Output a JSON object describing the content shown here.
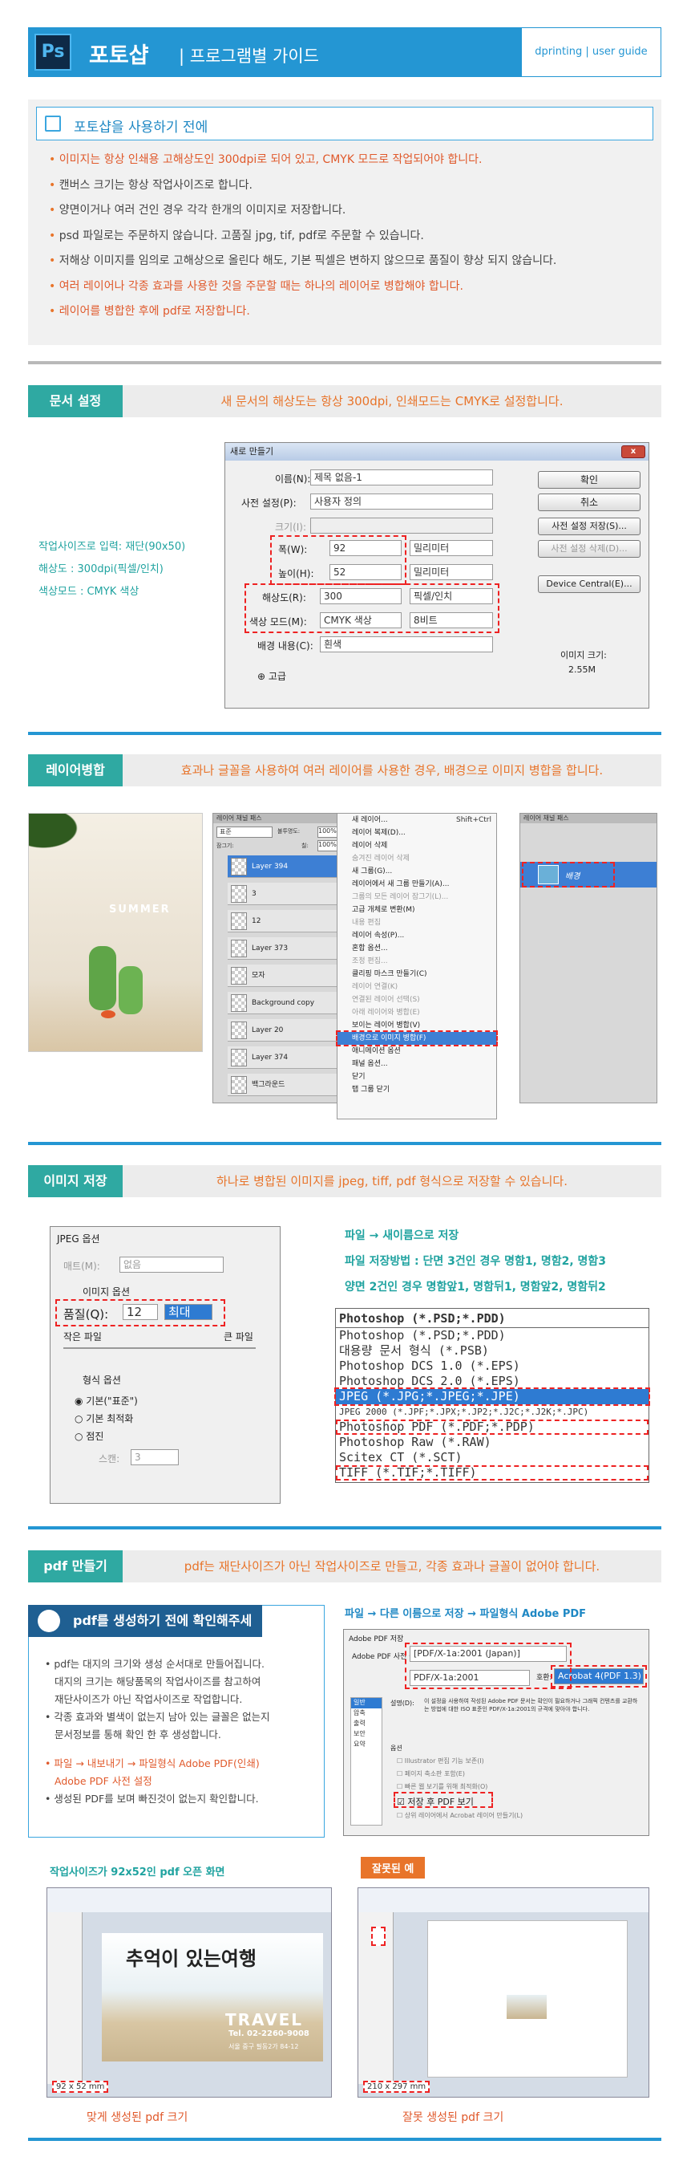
{
  "header": {
    "logo": "Ps",
    "title": "포토샵",
    "subtitle": "| 프로그램별 가이드",
    "right": "dprinting  |  user guide"
  },
  "intro": {
    "heading": "포토샵을 사용하기 전에",
    "items": [
      {
        "text": "이미지는 항상 인쇄용 고해상도인 300dpi로 되어 있고, CMYK 모드로 작업되어야 합니다.",
        "highlight": true
      },
      {
        "text": "캔버스 크기는 항상 작업사이즈로 합니다.",
        "highlight": false
      },
      {
        "text": "양면이거나 여러 건인 경우 각각 한개의 이미지로 저장합니다.",
        "highlight": false
      },
      {
        "text": "psd 파일로는 주문하지 않습니다. 고품질 jpg, tif, pdf로 주문할 수 있습니다.",
        "highlight": false
      },
      {
        "text": "저해상 이미지를 임의로 고해상으로 올린다 해도, 기본 픽셀은 변하지 않으므로 품질이 향상 되지 않습니다.",
        "highlight": false
      },
      {
        "text": "여러 레이어나 각종 효과를 사용한 것을 주문할 때는 하나의 레이어로 병합해야 합니다.",
        "highlight": true
      },
      {
        "text": "레이어를 병합한 후에 pdf로 저장합니다.",
        "highlight": true
      }
    ]
  },
  "doc": {
    "tag": "문서 설정",
    "desc": "새 문서의 해상도는 항상 300dpi, 인쇄모드는 CMYK로 설정합니다.",
    "notes": [
      "작업사이즈로 입력: 재단(90x50)",
      "해상도 : 300dpi(픽셀/인치)",
      "색상모드 : CMYK 색상"
    ],
    "dialog": {
      "title": "새로 만들기",
      "close": "x",
      "name_label": "이름(N):",
      "name_value": "제목 없음-1",
      "preset_label": "사전 설정(P):",
      "preset_value": "사용자 정의",
      "size_label": "크기(I):",
      "width_label": "폭(W):",
      "width_value": "92",
      "height_label": "높이(H):",
      "height_value": "52",
      "unit": "밀리미터",
      "res_label": "해상도(R):",
      "res_value": "300",
      "res_unit": "픽셀/인치",
      "mode_label": "색상 모드(M):",
      "mode_value": "CMYK 색상",
      "bits": "8비트",
      "bg_label": "배경 내용(C):",
      "bg_value": "흰색",
      "advanced": "고급",
      "ok": "확인",
      "cancel": "취소",
      "save_preset": "사전 설정 저장(S)...",
      "delete_preset": "사전 설정 삭제(D)...",
      "device": "Device Central(E)...",
      "img_size_label": "이미지 크기:",
      "img_size_value": "2.55M"
    }
  },
  "merge": {
    "tag": "레이어병합",
    "desc": "효과나 글꼴을 사용하여 여러 레이어를 사용한 경우, 배경으로 이미지 병합을 합니다.",
    "poster_text": "SUMMER",
    "panel_tabs": "레이어  채널  패스",
    "blend": "표준",
    "opacity_label": "불투명도:",
    "opacity": "100%",
    "lock": "잠그기:",
    "fill_label": "칠:",
    "fill": "100%",
    "layers": [
      "Layer 394",
      "3",
      "12",
      "Layer 373",
      "모자",
      "Background copy",
      "Layer 20",
      "Layer 374",
      "백그라운드"
    ],
    "menu_items": [
      "새 레이어...",
      "레이어 복제(D)...",
      "레이어 삭제",
      "숨겨진 레이어 삭제",
      "새 그룹(G)...",
      "레이어에서 새 그룹 만들기(A)...",
      "그룹의 모든 레이어 잠그기(L)...",
      "고급 개체로 변환(M)",
      "내용 편집",
      "레이어 속성(P)...",
      "혼합 옵션...",
      "조정 편집...",
      "클리핑 마스크 만들기(C)",
      "레이어 연결(K)",
      "연결된 레이어 선택(S)",
      "아래 레이어와 병합(E)",
      "보이는 레이어 병합(V)",
      "배경으로 이미지 병합(F)",
      "애니메이션 옵션",
      "패널 옵션...",
      "닫기",
      "탭 그룹 닫기"
    ],
    "menu_shortcut": "Shift+Ctrl",
    "merged_layer": "배경"
  },
  "save": {
    "tag": "이미지 저장",
    "desc": "하나로 병합된 이미지를 jpeg, tiff, pdf 형식으로 저장할 수 있습니다.",
    "notes": [
      "파일 → 새이름으로 저장",
      "파일 저장방법 : 단면 3건인 경우 명함1, 명함2, 명함3",
      "양면 2건인 경우 명함앞1, 명함뒤1, 명함앞2, 명함뒤2"
    ],
    "jpeg": {
      "title": "JPEG 옵션",
      "matte_label": "매트(M):",
      "matte_value": "없음",
      "img_opt": "이미지 옵션",
      "quality_label": "품질(Q):",
      "quality_value": "12",
      "quality_level": "최대",
      "small": "작은 파일",
      "large": "큰 파일",
      "format_opt": "형식 옵션",
      "r1": "기본(\"표준\")",
      "r2": "기본 최적화",
      "r3": "점진",
      "scan_label": "스캔:",
      "scan_value": "3"
    },
    "formats": [
      "Photoshop (*.PSD;*.PDD)",
      "Photoshop (*.PSD;*.PDD)",
      "대용량 문서 형식 (*.PSB)",
      "Photoshop DCS 1.0 (*.EPS)",
      "Photoshop DCS 2.0 (*.EPS)",
      "JPEG (*.JPG;*.JPEG;*.JPE)",
      "JPEG 2000 (*.JPF;*.JPX;*.JP2;*.J2C;*.J2K;*.JPC)",
      "Photoshop PDF (*.PDF;*.PDP)",
      "Photoshop Raw (*.RAW)",
      "Scitex CT (*.SCT)",
      "TIFF (*.TIF;*.TIFF)"
    ]
  },
  "pdf": {
    "tag": "pdf 만들기",
    "desc": "pdf는 재단사이즈가 아닌 작업사이즈로 만들고, 각종 효과나 글꼴이 없어야 합니다.",
    "box_title": "pdf를 생성하기 전에 확인해주세요",
    "items": [
      {
        "text": "pdf는 대지의 크기와 생성 순서대로 만들어집니다.",
        "o": false
      },
      {
        "text": "대지의 크기는 해당품목의 작업사이즈를 참고하여",
        "o": false
      },
      {
        "text": "재단사이즈가 아닌 작업사이즈로 작업합니다.",
        "o": false
      },
      {
        "text": "각종 효과와 별색이 없는지 남아 있는 글꼴은 없는지",
        "o": false
      },
      {
        "text": "문서정보를 통해 확인 한 후 생성합니다.",
        "o": false
      },
      {
        "text": "",
        "o": false
      },
      {
        "text": "파일 → 내보내기 → 파일형식 Adobe PDF(인쇄)",
        "o": true
      },
      {
        "text": "Adobe PDF 사전 설정",
        "o": true
      },
      {
        "text": "생성된 PDF를 보며 빠진것이 없는지 확인합니다.",
        "o": false
      }
    ],
    "right_title": "파일 → 다른 이름으로 저장 → 파일형식 Adobe PDF",
    "dlg_title": "Adobe PDF 저장",
    "preset_label": "Adobe PDF 사전 설정:",
    "preset": "[PDF/X-1a:2001 (Japan)]",
    "std": "PDF/X-1a:2001",
    "compat_label": "호환:",
    "compat": "Acrobat 4(PDF 1.3)",
    "side": [
      "일반",
      "압축",
      "출력",
      "보안",
      "요약"
    ],
    "desc_label": "설명(D):",
    "desc_text": "이 설정을 사용하여 작성된 Adobe PDF 문서는 확인이 필요하거나 그래픽 컨텐츠를 교환하는 방법에 대한 ISO 표준인 PDF/X-1a:2001의 규격에 맞아야 합니다.",
    "opt_label": "옵션",
    "opt1": "Illustrator 편집 기능 보존(I)",
    "opt2": "페이지 축소판 포함(E)",
    "opt3": "빠른 웹 보기를 위해 최적화(O)",
    "view": "저장 후 PDF 보기",
    "opt5": "상위 레이어에서 Acrobat 레이어 만들기(L)",
    "ok_caption_top": "작업사이즈가 92x52인 pdf 오픈 화면",
    "bad_tag": "잘못된 예",
    "card_title": "추억이 있는여행",
    "card_travel": "TRAVEL",
    "card_tel": "Tel. 02-2260-9008",
    "card_addr": "서울 중구 필동2가 84-12",
    "size_ok": "92 x 52 mm",
    "size_bad": "210 x 297 mm",
    "cap_ok": "맞게 생성된 pdf 크기",
    "cap_bad": "잘못 생성된 pdf 크기"
  },
  "colors": {
    "blue": "#2496d3",
    "teal": "#2fa9a2",
    "orange": "#e8742a",
    "red": "#e22222"
  }
}
